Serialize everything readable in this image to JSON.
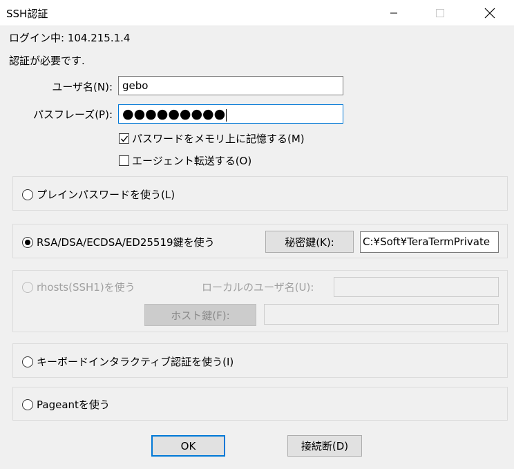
{
  "window": {
    "title": "SSH認証"
  },
  "header": {
    "login_info": "ログイン中: 104.215.1.4",
    "auth_required": "認証が必要です."
  },
  "credentials": {
    "username_label": "ユーザ名(N):",
    "username_value": "gebo",
    "passphrase_label": "パスフレーズ(P):",
    "passphrase_mask": "●●●●●●●●●",
    "remember_label": "パスワードをメモリ上に記憶する(M)",
    "remember_checked": true,
    "agent_forward_label": "エージェント転送する(O)",
    "agent_forward_checked": false
  },
  "methods": {
    "plain": {
      "label": "プレインパスワードを使う(L)",
      "selected": false
    },
    "rsa": {
      "label": "RSA/DSA/ECDSA/ED25519鍵を使う",
      "selected": true,
      "key_button": "秘密鍵(K):",
      "key_path": "C:¥Soft¥TeraTermPrivate"
    },
    "rhosts": {
      "label": "rhosts(SSH1)を使う",
      "selected": false,
      "local_user_label": "ローカルのユーザ名(U):",
      "local_user_value": "",
      "host_key_button": "ホスト鍵(F):",
      "host_key_value": ""
    },
    "keyboard": {
      "label": "キーボードインタラクティブ認証を使う(I)",
      "selected": false
    },
    "pageant": {
      "label": "Pageantを使う",
      "selected": false
    }
  },
  "footer": {
    "ok_label": "OK",
    "disconnect_label": "接続断(D)"
  }
}
